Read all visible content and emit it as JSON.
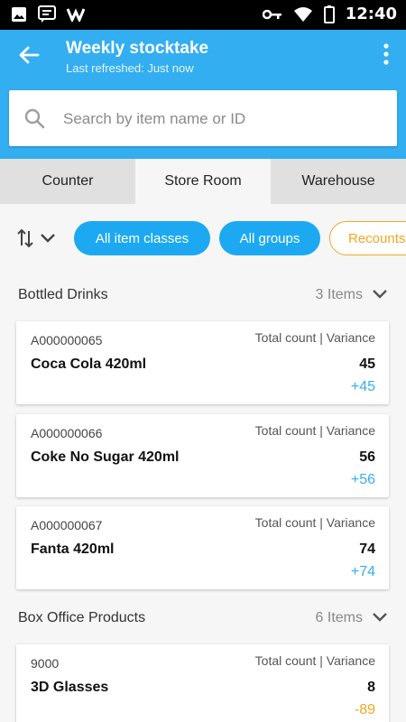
{
  "statusbar": {
    "time": "12:40"
  },
  "header": {
    "title": "Weekly stocktake",
    "subtitle": "Last refreshed: Just now"
  },
  "search": {
    "placeholder": "Search by item name or ID"
  },
  "tabs": [
    {
      "label": "Counter"
    },
    {
      "label": "Store Room",
      "active": true
    },
    {
      "label": "Warehouse"
    }
  ],
  "filters": {
    "chips": [
      {
        "label": "All item classes"
      },
      {
        "label": "All groups"
      },
      {
        "label": "Recounts"
      }
    ]
  },
  "groups": [
    {
      "name": "Bottled Drinks",
      "count_label": "3 Items",
      "items": [
        {
          "code": "A000000065",
          "header": "Total count | Variance",
          "name": "Coca Cola 420ml",
          "count": "45",
          "variance": "+45"
        },
        {
          "code": "A000000066",
          "header": "Total count | Variance",
          "name": "Coke No Sugar 420ml",
          "count": "56",
          "variance": "+56"
        },
        {
          "code": "A000000067",
          "header": "Total count | Variance",
          "name": "Fanta 420ml",
          "count": "74",
          "variance": "+74"
        }
      ]
    },
    {
      "name": "Box Office Products",
      "count_label": "6 Items",
      "items": [
        {
          "code": "9000",
          "header": "Total count | Variance",
          "name": "3D Glasses",
          "count": "8",
          "variance": "-89"
        }
      ]
    }
  ],
  "colors": {
    "accent": "#33aef0",
    "chip": "#1ca9f2",
    "warning": "#f5a623"
  }
}
